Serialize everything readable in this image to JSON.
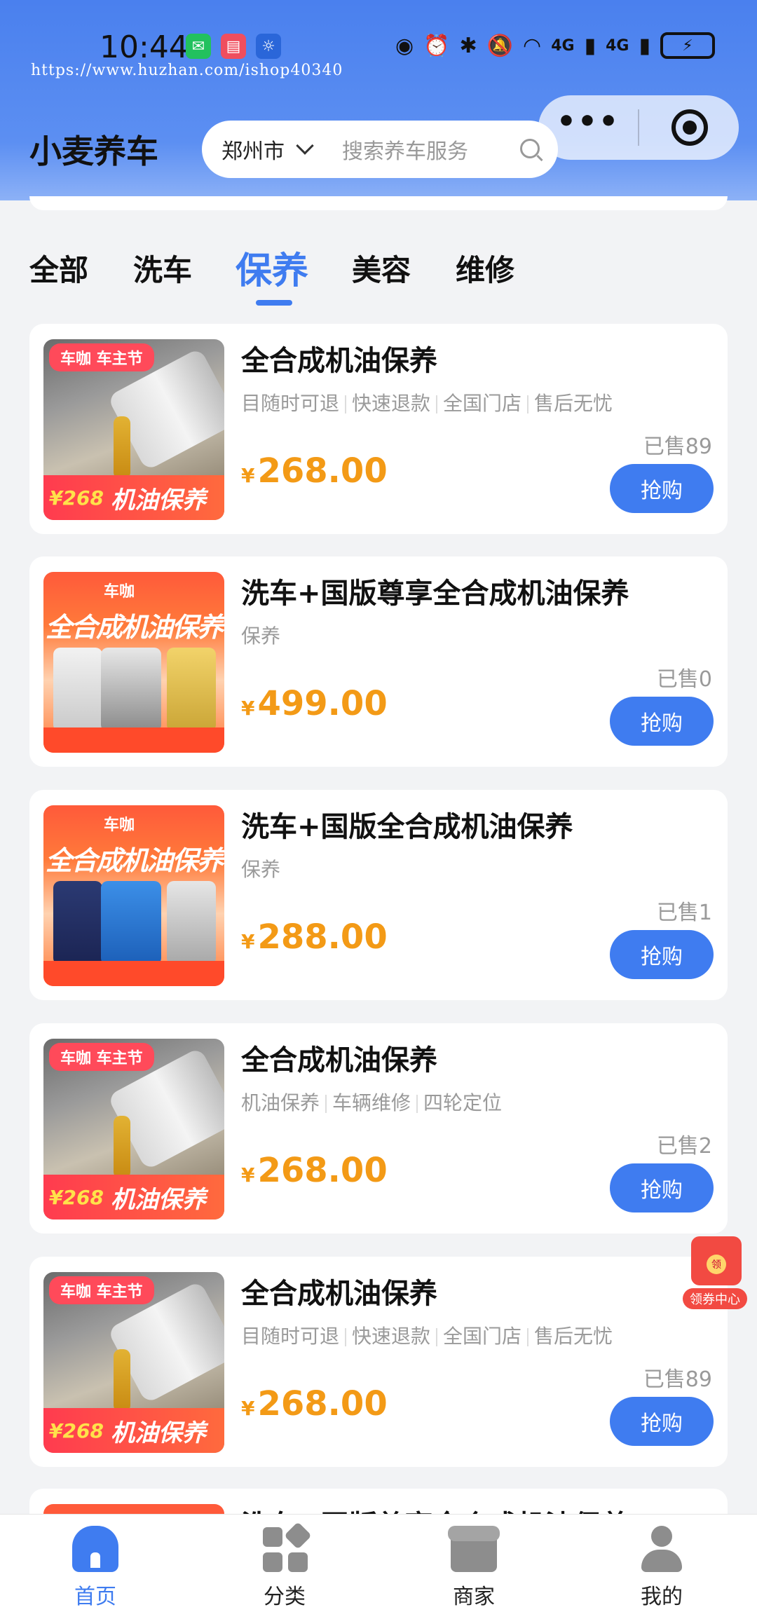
{
  "status_bar": {
    "time": "10:44",
    "watermark": "https://www.huzhan.com/ishop40340",
    "net1": "4G",
    "net2": "4G"
  },
  "header": {
    "app_title": "小麦养车",
    "city": "郑州市",
    "search_placeholder": "搜索养车服务"
  },
  "tabs": [
    "全部",
    "洗车",
    "保养",
    "美容",
    "维修"
  ],
  "active_tab": "保养",
  "products": [
    {
      "title": "全合成机油保养",
      "tags": [
        "目随时可退",
        "快速退款",
        "全国门店",
        "售后无忧"
      ],
      "currency": "¥",
      "price": "268.00",
      "sold": "已售89",
      "buy_label": "抢购",
      "thumb": {
        "banner": "车咖 车主节",
        "price": "¥268",
        "title": "机油保养"
      }
    },
    {
      "title": "洗车+国版尊享全合成机油保养",
      "tags": [
        "保养"
      ],
      "currency": "¥",
      "price": "499.00",
      "sold": "已售0",
      "buy_label": "抢购",
      "thumb": {
        "logo": "车咖",
        "title": "全合成机油保养"
      }
    },
    {
      "title": "洗车+国版全合成机油保养",
      "tags": [
        "保养"
      ],
      "currency": "¥",
      "price": "288.00",
      "sold": "已售1",
      "buy_label": "抢购",
      "thumb": {
        "logo": "车咖",
        "title": "全合成机油保养"
      }
    },
    {
      "title": "全合成机油保养",
      "tags": [
        "机油保养",
        "车辆维修",
        "四轮定位"
      ],
      "currency": "¥",
      "price": "268.00",
      "sold": "已售2",
      "buy_label": "抢购",
      "thumb": {
        "banner": "车咖 车主节",
        "price": "¥268",
        "title": "机油保养"
      }
    },
    {
      "title": "全合成机油保养",
      "tags": [
        "目随时可退",
        "快速退款",
        "全国门店",
        "售后无忧"
      ],
      "currency": "¥",
      "price": "268.00",
      "sold": "已售89",
      "buy_label": "抢购",
      "thumb": {
        "banner": "车咖 车主节",
        "price": "¥268",
        "title": "机油保养"
      }
    },
    {
      "title": "洗车+国版尊享全合成机油保养"
    }
  ],
  "coupon": {
    "seal": "领",
    "label": "领券中心"
  },
  "bottom_nav": [
    {
      "label": "首页",
      "icon": "home-icon"
    },
    {
      "label": "分类",
      "icon": "category-icon"
    },
    {
      "label": "商家",
      "icon": "shop-icon"
    },
    {
      "label": "我的",
      "icon": "user-icon"
    }
  ],
  "colors": {
    "accent": "#3f7cf0",
    "price": "#f39a16",
    "header": "#5c8ff2"
  }
}
